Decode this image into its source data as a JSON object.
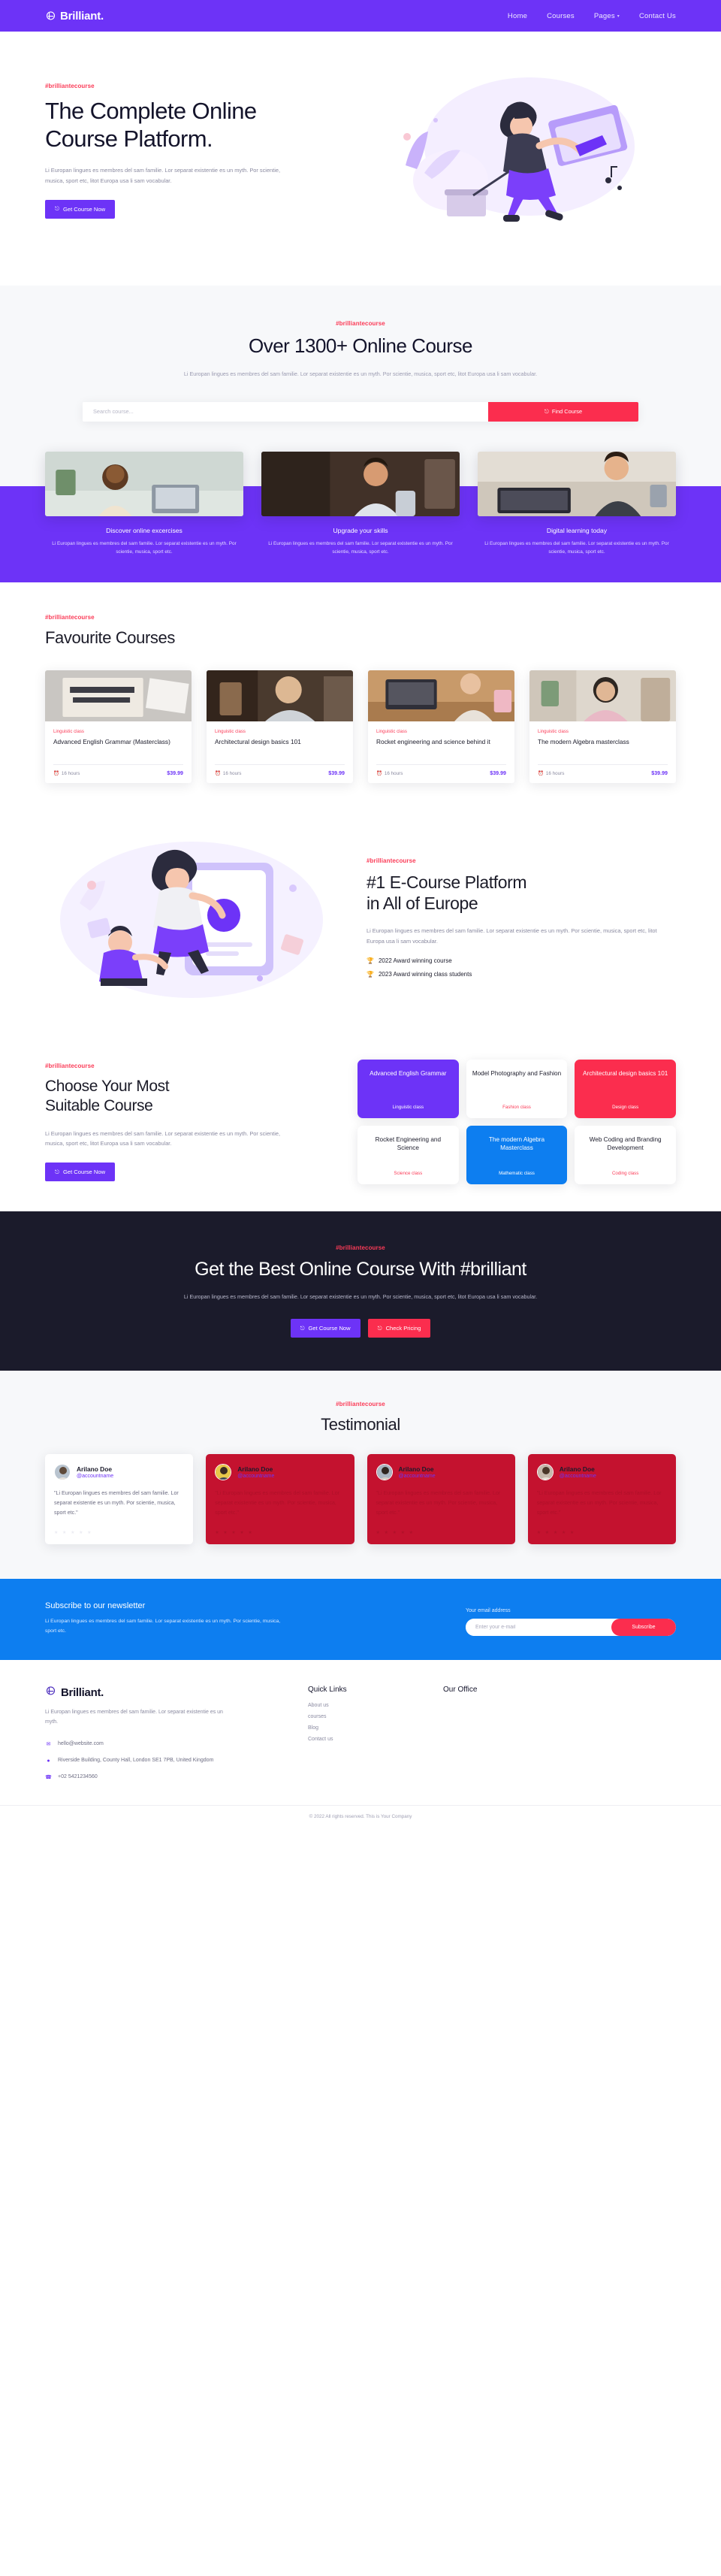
{
  "nav": {
    "brand": "Brilliant.",
    "brand_icon": "book-logo-icon",
    "links": [
      {
        "label": "Home"
      },
      {
        "label": "Courses"
      },
      {
        "label": "Pages",
        "caret": "▾"
      },
      {
        "label": "Contact Us"
      }
    ]
  },
  "hero": {
    "eyebrow": "#brilliantecourse",
    "title_line1": "The Complete Online",
    "title_line2": "Course Platform.",
    "paragraph": "Li Europan lingues es membres del sam familie. Lor separat existentie es un myth. Por scientie, musica, sport etc, litot Europa usa li sam vocabular.",
    "cta_label": "Get Course Now",
    "cta_icon": "external-link-icon"
  },
  "search_section": {
    "eyebrow": "#brilliantecourse",
    "title": "Over 1300+ Online Course",
    "subtitle": "Li Europan lingues es membres del sam familie. Lor separat existentie es un myth. Por scientie, musica, sport etc, litot Europa usa li sam vocabular.",
    "input_placeholder": "Search course...",
    "input_value": "",
    "find_label": "Find Course",
    "find_icon": "external-link-icon"
  },
  "features": [
    {
      "title": "Discover online excercises",
      "text": "Li Europan lingues es membres del sam familie. Lor separat existentie es un myth. Por scientie, musica, sport etc."
    },
    {
      "title": "Upgrade your skills",
      "text": "Li Europan lingues es membres del sam familie. Lor separat existentie es un myth. Por scientie, musica, sport etc."
    },
    {
      "title": "Digital learning today",
      "text": "Li Europan lingues es membres del sam familie. Lor separat existentie es un myth. Por scientie, musica, sport etc."
    }
  ],
  "favourite": {
    "eyebrow": "#brilliantecourse",
    "title": "Favourite Courses",
    "courses": [
      {
        "tag": "Linguistic class",
        "name": "Advanced English Grammar (Masterclass)",
        "hours": "16 hours",
        "price": "$39.99",
        "clock_icon": "clock-icon"
      },
      {
        "tag": "Linguistic class",
        "name": "Architectural design basics 101",
        "hours": "16 hours",
        "price": "$39.99",
        "clock_icon": "clock-icon"
      },
      {
        "tag": "Linguistic class",
        "name": "Rocket engineering and science behind it",
        "hours": "16 hours",
        "price": "$39.99",
        "clock_icon": "clock-icon"
      },
      {
        "tag": "Linguistic class",
        "name": "The modern Algebra masterclass",
        "hours": "16 hours",
        "price": "$39.99",
        "clock_icon": "clock-icon"
      }
    ]
  },
  "platform": {
    "eyebrow": "#brilliantecourse",
    "title_line1": "#1 E-Course Platform",
    "title_line2": "in All of Europe",
    "paragraph": "Li Europan lingues es membres del sam familie. Lor separat existentie es un myth. Por scientie, musica, sport etc, litot Europa usa li sam vocabular.",
    "awards": [
      {
        "icon": "trophy-icon",
        "label": "2022 Award winning course"
      },
      {
        "icon": "trophy-icon",
        "label": "2023 Award winning class students"
      }
    ]
  },
  "suitable": {
    "eyebrow": "#brilliantecourse",
    "title_line1": "Choose Your Most",
    "title_line2": "Suitable Course",
    "paragraph": "Li Europan lingues es membres del sam familie. Lor separat existentie es un myth. Por scientie, musica, sport etc, litot Europa usa li sam vocabular.",
    "cta_label": "Get Course Now",
    "cta_icon": "external-link-icon",
    "tiles": [
      {
        "name": "Advanced English Grammar",
        "class": "Linguistic class",
        "style": "purple"
      },
      {
        "name": "Model Photography and Fashion",
        "class": "Fashion class",
        "style": "white"
      },
      {
        "name": "Architectural design basics 101",
        "class": "Design class",
        "style": "red"
      },
      {
        "name": "Rocket Engineering and Science",
        "class": "Science class",
        "style": "white"
      },
      {
        "name": "The modern Algebra Masterclass",
        "class": "Mathematic class",
        "style": "blue"
      },
      {
        "name": "Web Coding and Branding Development",
        "class": "Coding class",
        "style": "white"
      }
    ]
  },
  "dark_cta": {
    "eyebrow": "#brilliantecourse",
    "title": "Get the Best Online Course With #brilliant",
    "subtitle": "Li Europan lingues es membres del sam familie. Lor separat existentie es un myth. Por scientie, musica, sport etc, litot Europa usa li sam vocabular.",
    "primary_label": "Get Course Now",
    "primary_icon": "external-link-icon",
    "secondary_label": "Check Pricing",
    "secondary_icon": "external-link-icon"
  },
  "testimonial": {
    "eyebrow": "#brilliantecourse",
    "title": "Testimonial",
    "cards": [
      {
        "name": "Arilano Doe",
        "handle": "@accountname",
        "quote": "\"Li Europan lingues es membres del sam familie. Lor separat existentie es un myth. Por scientie, musica, sport etc.\"",
        "stars": "★ ★ ★ ★ ★",
        "style": "light"
      },
      {
        "name": "Arilano Doe",
        "handle": "@accountname",
        "quote": "\"Li Europan lingues es membres del sam familie. Lor separat existentie es un myth. Por scientie, musica, sport etc.\"",
        "stars": "★ ★ ★ ★ ★",
        "style": "red"
      },
      {
        "name": "Arilano Doe",
        "handle": "@accountname",
        "quote": "\"Li Europan lingues es membres del sam familie. Lor separat existentie es un myth. Por scientie, musica, sport etc.\"",
        "stars": "★ ★ ★ ★ ★",
        "style": "red"
      },
      {
        "name": "Arilano Doe",
        "handle": "@accountname",
        "quote": "\"Li Europan lingues es membres del sam familie. Lor separat existentie es un myth. Por scientie, musica, sport etc.\"",
        "stars": "★ ★ ★ ★ ★",
        "style": "red"
      }
    ]
  },
  "newsletter": {
    "title": "Subscribe to our newsletter",
    "text": "Li Europan lingues es membres del sam familie. Lor separat existentie es un myth. Por scientie, musica, sport etc.",
    "field_label": "Your email address",
    "input_placeholder": "Enter your e-mail",
    "input_value": "",
    "button_label": "Subscribe"
  },
  "footer": {
    "brand": "Brilliant.",
    "brand_icon": "book-logo-icon",
    "description": "Li Europan lingues es membres del sam familie. Lor separat existentie es un myth.",
    "contacts": [
      {
        "icon": "envelope-icon",
        "text": "hello@website.com"
      },
      {
        "icon": "location-pin-icon",
        "text": "Riverside Building, County Hall, London SE1 7PB, United Kingdom"
      },
      {
        "icon": "phone-icon",
        "text": "+02 5421234560"
      }
    ],
    "quick_links_title": "Quick Links",
    "quick_links": [
      {
        "label": "About us"
      },
      {
        "label": "courses"
      },
      {
        "label": "Blog"
      },
      {
        "label": "Contact us"
      }
    ],
    "office_title": "Our Office",
    "copyright": "© 2022 All rights reserved. This is Your Company"
  },
  "colors": {
    "primary": "#6d33f7",
    "accent_red": "#fb2d4e",
    "accent_blue": "#0d7ef0",
    "dark": "#1b1b2b",
    "deep_red": "#c4122f"
  }
}
